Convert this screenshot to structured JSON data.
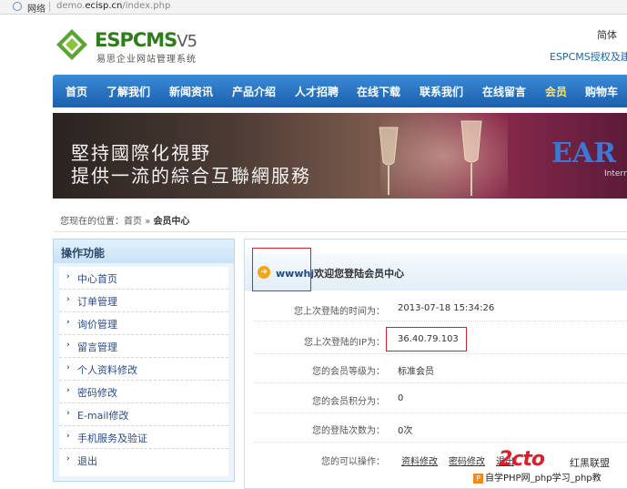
{
  "address_bar": {
    "network_label": "网络",
    "url_prefix": "demo.",
    "url_domain": "ecisp.cn",
    "url_path": "/index.php"
  },
  "header": {
    "brand_main": "ESPCMS",
    "brand_version": "V5",
    "brand_sub": "易思企业网站管理系统",
    "top_link_1": "简体",
    "top_link_2": "ESPCMS授权及建"
  },
  "nav": {
    "items": [
      "首页",
      "了解我们",
      "新闻资讯",
      "产品介绍",
      "人才招聘",
      "在线下载",
      "联系我们",
      "在线留言",
      "会员",
      "购物车"
    ],
    "active_index": 8
  },
  "banner": {
    "line1": "堅持國際化視野",
    "line2": "提供一流的綜合互聯網服務",
    "logo_text": "EAR",
    "logo_sub": "Intern"
  },
  "breadcrumb": {
    "prefix": "您现在的位置：",
    "home": "首页",
    "separator": "»",
    "current": "会员中心"
  },
  "sidebar": {
    "title": "操作功能",
    "items": [
      "中心首页",
      "订单管理",
      "询价管理",
      "留言管理",
      "个人资料修改",
      "密码修改",
      "E-mail修改",
      "手机服务及验证",
      "退出"
    ]
  },
  "main": {
    "username": "wwwhj",
    "welcome_suffix": "欢迎您登陆会员中心",
    "rows": [
      {
        "label": "您上次登陆的时间为：",
        "value": "2013-07-18 15:34:26"
      },
      {
        "label": "您上次登陆的IP为：",
        "value": "36.40.79.103"
      },
      {
        "label": "您的会员等级为：",
        "value": "标准会员"
      },
      {
        "label": "您的会员积分为：",
        "value": "0"
      },
      {
        "label": "您的登陆次数为：",
        "value": "0次"
      },
      {
        "label": "您的可以操作：",
        "value": ""
      }
    ],
    "operations": [
      "资料修改",
      "密码修改",
      "退出"
    ]
  },
  "watermark": {
    "logo": "2cto",
    "league": "红黑联盟",
    "icon_letter": "P",
    "caption": "自学PHP网_php学习_php教"
  },
  "colors": {
    "nav_blue": "#1a5fae",
    "active_nav": "#ffe066",
    "highlight_red": "#d8202a"
  }
}
